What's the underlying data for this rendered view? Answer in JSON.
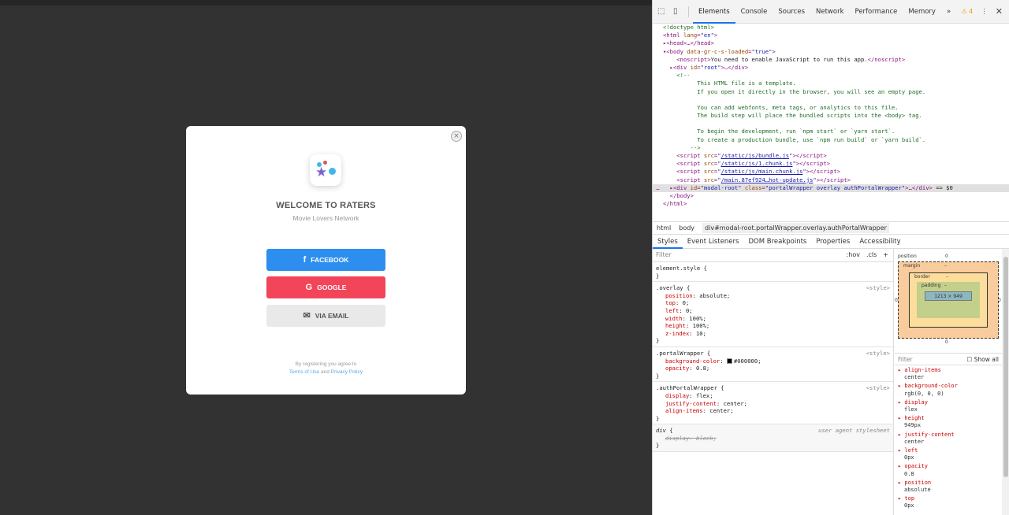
{
  "modal": {
    "close_label": "×",
    "title": "WELCOME TO RATERS",
    "subtitle": "Movie Lovers Network",
    "facebook": {
      "icon": "f",
      "label": "FACEBOOK"
    },
    "google": {
      "icon": "G",
      "label": "GOOGLE"
    },
    "email": {
      "icon": "✉",
      "label": "VIA EMAIL"
    },
    "legal_line1": "By registering you agree to",
    "terms": "Terms of Use",
    "and": "and",
    "privacy": "Privacy Policy",
    "colors": {
      "facebook": "#2d8ef0",
      "google": "#f2455a",
      "email": "#e9e9e9"
    }
  },
  "devtools": {
    "tabs": [
      "Elements",
      "Console",
      "Sources",
      "Network",
      "Performance",
      "Memory"
    ],
    "more": "»",
    "warnings": "⚠ 4",
    "menu": "⋮",
    "close": "✕",
    "breadcrumbs": [
      "html",
      "body",
      "div#modal-root.portalWrapper.overlay.authPortalWrapper"
    ],
    "subtabs": [
      "Styles",
      "Event Listeners",
      "DOM Breakpoints",
      "Properties",
      "Accessibility"
    ],
    "filter_placeholder": "Filter",
    "hov": ":hov",
    "cls": ".cls",
    "plus": "+",
    "computed_filter": "Filter",
    "show_all": "Show all",
    "box_model": {
      "position_label": "position",
      "position_top": "0",
      "position_left": "0",
      "position_right": "0",
      "position_bottom": "0",
      "margin_label": "margin",
      "margin_val": "–",
      "border_label": "border",
      "border_val": "–",
      "padding_label": "padding",
      "padding_val": "–",
      "content": "1213 × 949"
    },
    "computed": [
      {
        "name": "align-items",
        "value": "center"
      },
      {
        "name": "background-color",
        "value": "rgb(0, 0, 0)"
      },
      {
        "name": "display",
        "value": "flex"
      },
      {
        "name": "height",
        "value": "949px"
      },
      {
        "name": "justify-content",
        "value": "center"
      },
      {
        "name": "left",
        "value": "0px"
      },
      {
        "name": "opacity",
        "value": "0.8"
      },
      {
        "name": "position",
        "value": "absolute"
      },
      {
        "name": "top",
        "value": "0px"
      }
    ]
  }
}
